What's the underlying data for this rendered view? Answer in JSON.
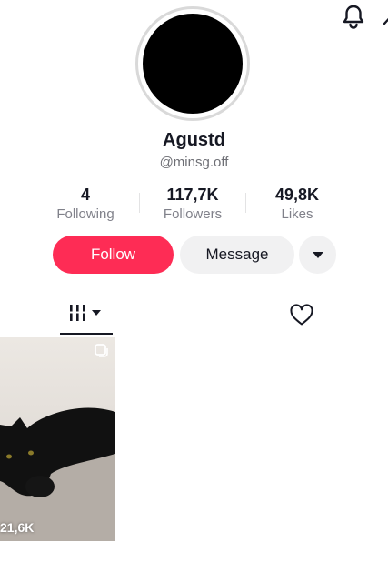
{
  "profile": {
    "display_name": "Agustd",
    "username": "@minsg.off"
  },
  "stats": [
    {
      "value": "4",
      "label": "Following"
    },
    {
      "value": "117,7K",
      "label": "Followers"
    },
    {
      "value": "49,8K",
      "label": "Likes"
    }
  ],
  "actions": {
    "follow_label": "Follow",
    "message_label": "Message",
    "more_icon": "caret-down-icon"
  },
  "tabs": [
    {
      "icon": "videos-grid-icon",
      "selected": true
    },
    {
      "icon": "heart-outline-icon",
      "selected": false
    }
  ],
  "videos": [
    {
      "views": "21,6K",
      "icon": "multi-photo-icon"
    }
  ],
  "colors": {
    "follow": "#fe2c55",
    "secondary_button": "#f1f1f2",
    "text": "#161823",
    "muted": "#80818a"
  }
}
